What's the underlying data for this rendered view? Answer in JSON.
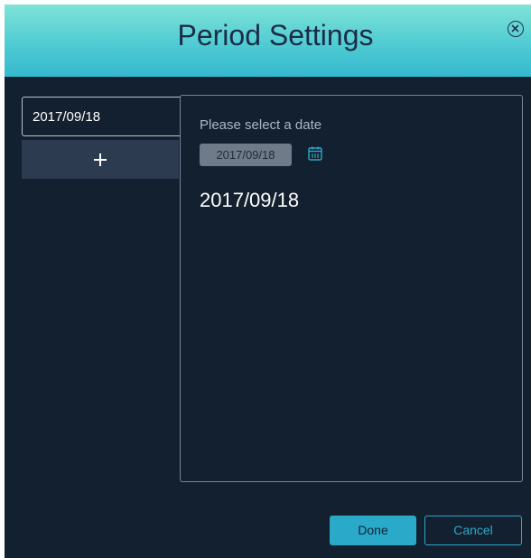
{
  "dialog": {
    "title": "Period Settings",
    "close_icon": "close-circle-icon"
  },
  "periods": {
    "items": [
      {
        "label": "2017/09/18"
      }
    ],
    "add_icon": "plus-icon"
  },
  "detail": {
    "prompt": "Please select a date",
    "date_input_value": "2017/09/18",
    "calendar_icon": "calendar-icon",
    "selected_date": "2017/09/18"
  },
  "footer": {
    "done_label": "Done",
    "cancel_label": "Cancel"
  },
  "colors": {
    "header_top": "#7fe3d7",
    "header_bottom": "#35b8ce",
    "background": "#13202f",
    "accent": "#2aa9c9"
  }
}
